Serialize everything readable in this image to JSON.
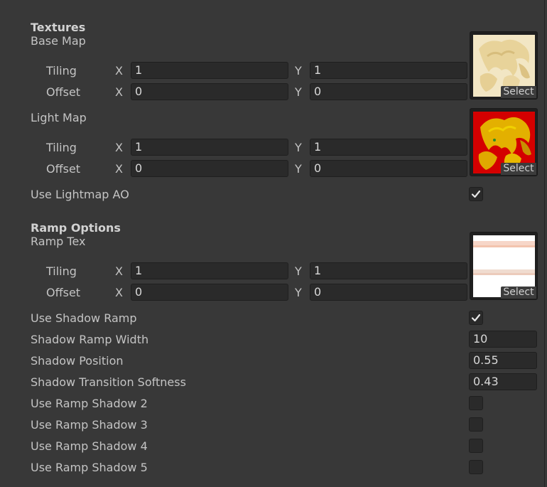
{
  "textures": {
    "header": "Textures",
    "base_map": {
      "label": "Base Map",
      "tiling_label": "Tiling",
      "offset_label": "Offset",
      "x_label": "X",
      "y_label": "Y",
      "tiling_x": "1",
      "tiling_y": "1",
      "offset_x": "0",
      "offset_y": "0",
      "select": "Select"
    },
    "light_map": {
      "label": "Light Map",
      "tiling_label": "Tiling",
      "offset_label": "Offset",
      "x_label": "X",
      "y_label": "Y",
      "tiling_x": "1",
      "tiling_y": "1",
      "offset_x": "0",
      "offset_y": "0",
      "select": "Select"
    },
    "use_lightmap_ao": {
      "label": "Use Lightmap AO",
      "checked": true
    }
  },
  "ramp": {
    "header": "Ramp Options",
    "ramp_tex": {
      "label": "Ramp Tex",
      "tiling_label": "Tiling",
      "offset_label": "Offset",
      "x_label": "X",
      "y_label": "Y",
      "tiling_x": "1",
      "tiling_y": "1",
      "offset_x": "0",
      "offset_y": "0",
      "select": "Select"
    },
    "use_shadow_ramp": {
      "label": "Use Shadow Ramp",
      "checked": true
    },
    "shadow_ramp_width": {
      "label": "Shadow Ramp Width",
      "value": "10"
    },
    "shadow_position": {
      "label": "Shadow Position",
      "value": "0.55"
    },
    "shadow_transition_softness": {
      "label": "Shadow Transition Softness",
      "value": "0.43"
    },
    "use_ramp_shadow_2": {
      "label": "Use Ramp Shadow 2",
      "checked": false
    },
    "use_ramp_shadow_3": {
      "label": "Use Ramp Shadow 3",
      "checked": false
    },
    "use_ramp_shadow_4": {
      "label": "Use Ramp Shadow 4",
      "checked": false
    },
    "use_ramp_shadow_5": {
      "label": "Use Ramp Shadow 5",
      "checked": false
    }
  },
  "icons": {
    "checkmark": "checkmark-icon"
  },
  "colors": {
    "panel_bg": "#383838",
    "field_bg": "#2a2a2a",
    "text": "#c4c4c4",
    "light_map_red": "#d40000"
  }
}
